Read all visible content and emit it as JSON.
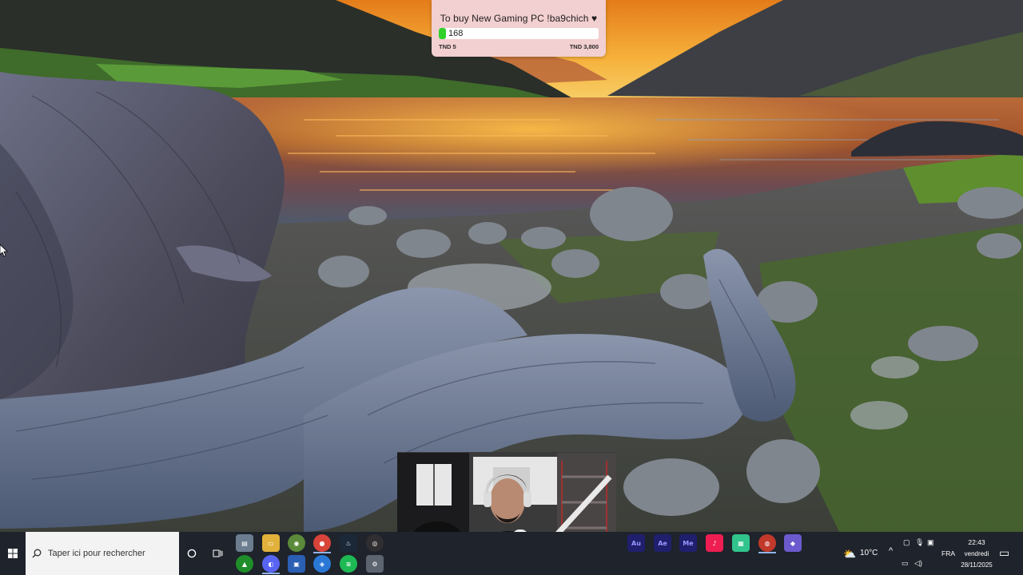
{
  "goal_widget": {
    "title": "To buy New Gaming PC !ba9chich ♥",
    "current_amount": "168",
    "min_label": "TND 5",
    "max_label": "TND 3,800",
    "progress_fraction": 0.044,
    "bar_color": "#2fd12a",
    "background_color": "#f2cfd0"
  },
  "taskbar": {
    "search_placeholder": "Taper ici pour rechercher",
    "pinned_top": [
      "file-manager-icon",
      "file-explorer-icon",
      "browser-app-icon",
      "chrome-icon",
      "steam-icon",
      "obs-icon"
    ],
    "pinned_bottom": [
      "razer-icon",
      "discord-icon",
      "app-icon",
      "app-icon",
      "spotify-icon",
      "app-icon"
    ],
    "adobe_apps": [
      {
        "label": "Au",
        "color": "#1f1f6e",
        "text_color": "#9999ff"
      },
      {
        "label": "Ae",
        "color": "#1f1f6e",
        "text_color": "#9999ff"
      },
      {
        "label": "Me",
        "color": "#1f1f6e",
        "text_color": "#9999ff"
      }
    ],
    "weather": {
      "temperature": "10°C"
    },
    "language": "FRA",
    "clock": {
      "time": "22:43",
      "day": "vendredi",
      "date": "28/11/2025"
    }
  }
}
